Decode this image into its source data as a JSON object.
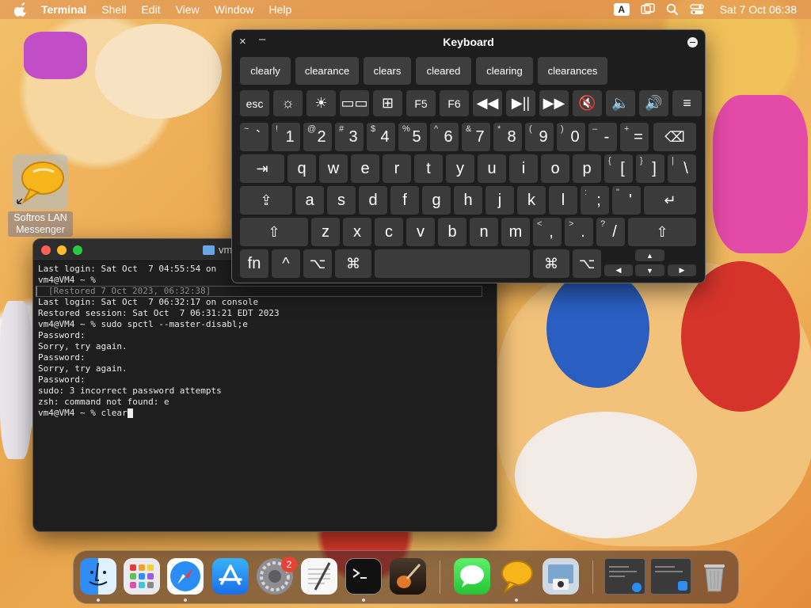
{
  "menubar": {
    "app_name": "Terminal",
    "items": [
      "Shell",
      "Edit",
      "View",
      "Window",
      "Help"
    ],
    "input_source": "A",
    "datetime": "Sat 7 Oct  06:38"
  },
  "desktop_icon": {
    "label_line1": "Softros LAN",
    "label_line2": "Messenger"
  },
  "terminal": {
    "title": "vm",
    "lines": [
      "Last login: Sat Oct  7 04:55:54 on",
      "vm4@VM4 ~ %",
      "[Restored 7 Oct 2023, 06:32:38]",
      "Last login: Sat Oct  7 06:32:17 on console",
      "Restored session: Sat Oct  7 06:31:21 EDT 2023",
      "vm4@VM4 ~ % sudo spctl --master-disabl;e",
      "Password:",
      "Sorry, try again.",
      "Password:",
      "Sorry, try again.",
      "Password:",
      "sudo: 3 incorrect password attempts",
      "zsh: command not found: e",
      "vm4@VM4 ~ % clear"
    ]
  },
  "keyboard": {
    "title": "Keyboard",
    "close": "×",
    "minimize": "–",
    "suggestions": [
      "clearly",
      "clearance",
      "clears",
      "cleared",
      "clearing",
      "clearances"
    ],
    "fn_row": [
      "esc",
      "☼",
      "☀",
      "▭▭",
      "⊞",
      "F5",
      "F6",
      "◀◀",
      "▶||",
      "▶▶",
      "🔇",
      "🔈",
      "🔊",
      "≡"
    ],
    "num_row": [
      {
        "main": "`",
        "shift": "~"
      },
      {
        "main": "1",
        "shift": "!"
      },
      {
        "main": "2",
        "shift": "@"
      },
      {
        "main": "3",
        "shift": "#"
      },
      {
        "main": "4",
        "shift": "$"
      },
      {
        "main": "5",
        "shift": "%"
      },
      {
        "main": "6",
        "shift": "^"
      },
      {
        "main": "7",
        "shift": "&"
      },
      {
        "main": "8",
        "shift": "*"
      },
      {
        "main": "9",
        "shift": "("
      },
      {
        "main": "0",
        "shift": ")"
      },
      {
        "main": "-",
        "shift": "–"
      },
      {
        "main": "=",
        "shift": "+"
      }
    ],
    "backspace": "⌫",
    "tab": "⇥",
    "qwerty_row": [
      "q",
      "w",
      "e",
      "r",
      "t",
      "y",
      "u",
      "i",
      "o",
      "p"
    ],
    "bracket_open": {
      "main": "[",
      "shift": "{"
    },
    "bracket_close": {
      "main": "]",
      "shift": "}"
    },
    "backslash": {
      "main": "\\",
      "shift": "|"
    },
    "caps": "⇪",
    "home_row": [
      "a",
      "s",
      "d",
      "f",
      "g",
      "h",
      "j",
      "k",
      "l"
    ],
    "semicolon": {
      "main": ";",
      "shift": ":"
    },
    "quote": {
      "main": "'",
      "shift": "\""
    },
    "return": "↵",
    "shift": "⇧",
    "bottom_row": [
      "z",
      "x",
      "c",
      "v",
      "b",
      "n",
      "m"
    ],
    "comma": {
      "main": ",",
      "shift": "<"
    },
    "period": {
      "main": ".",
      "shift": ">"
    },
    "slash": {
      "main": "/",
      "shift": "?"
    },
    "fn": "fn",
    "control": "^",
    "option": "⌥",
    "command": "⌘",
    "arrow_up": "▲",
    "arrow_left": "◀",
    "arrow_down": "▼",
    "arrow_right": "▶"
  },
  "dock": {
    "settings_badge": "2"
  }
}
